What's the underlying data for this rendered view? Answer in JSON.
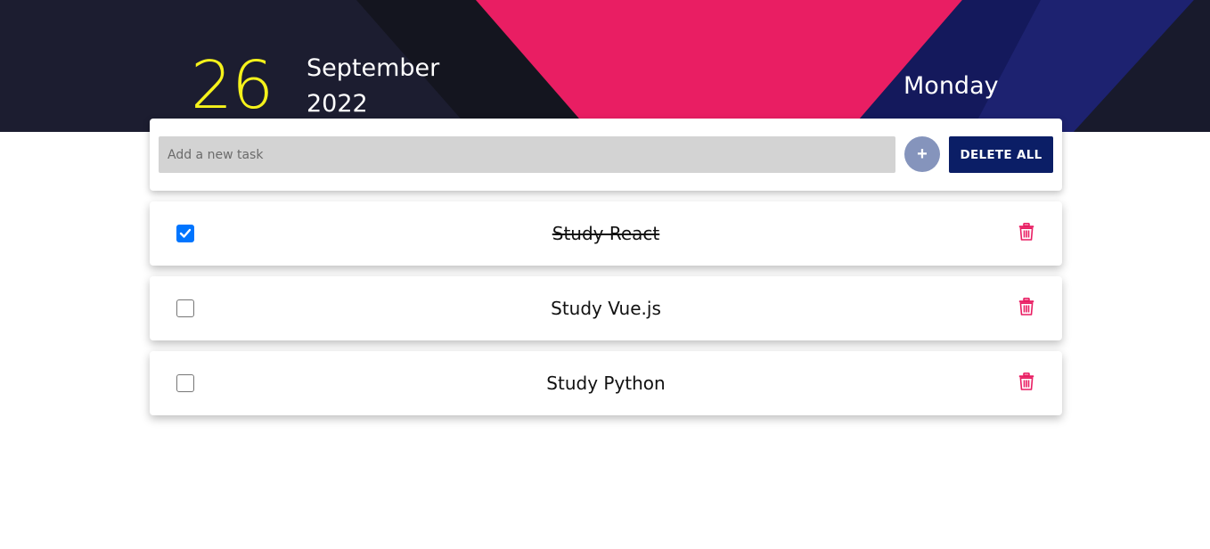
{
  "header": {
    "day": "26",
    "month": "September",
    "year": "2022",
    "weekday": "Monday"
  },
  "add_task": {
    "placeholder": "Add a new task",
    "add_label": "+",
    "delete_all_label": "DELETE ALL"
  },
  "tasks": [
    {
      "label": "Study React",
      "done": true
    },
    {
      "label": "Study Vue.js",
      "done": false
    },
    {
      "label": "Study Python",
      "done": false
    }
  ],
  "colors": {
    "header_dark": "#1b1c30",
    "header_pink": "#e91e63",
    "header_navy": "#14195c",
    "day_yellow": "#f5f21b",
    "delete_button": "#0b1e66",
    "add_button": "#8594bc",
    "trash": "#e91e63",
    "checkbox_checked": "#0075ff"
  }
}
